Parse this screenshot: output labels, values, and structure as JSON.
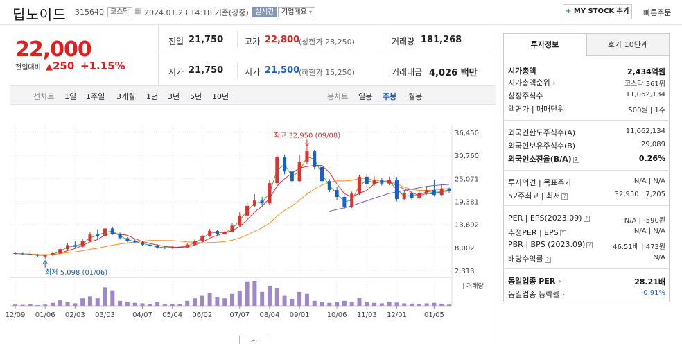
{
  "header": {
    "stock_name": "딥노이드",
    "stock_code": "315640",
    "market": "코스닥",
    "datetime": "2024.01.23 14:18",
    "basis": "기준(장중)",
    "realtime": "실시간",
    "company_info": "기업개요",
    "mystock_button": "MY STOCK 추가",
    "quick_order": "빠른주문"
  },
  "price": {
    "current": "22,000",
    "diff_label": "전일대비",
    "diff_value": "250",
    "diff_pct": "+1.15%"
  },
  "quote": {
    "prev_label": "전일",
    "prev": "21,750",
    "high_label": "고가",
    "high": "22,800",
    "upper_limit": "(상한가 28,250)",
    "volume_label": "거래량",
    "volume": "181,268",
    "open_label": "시가",
    "open": "21,750",
    "low_label": "저가",
    "low": "21,500",
    "lower_limit": "(하한가 15,250)",
    "amount_label": "거래대금",
    "amount": "4,026 백만"
  },
  "periods": {
    "line_label": "선차트",
    "line_items": [
      "1일",
      "1주일",
      "3개월",
      "1년",
      "3년",
      "5년",
      "10년"
    ],
    "candle_label": "봉차트",
    "candle_items": [
      "일봉",
      "주봉",
      "월봉"
    ],
    "active_candle": "주봉"
  },
  "info_tabs": [
    "투자정보",
    "호가 10단계"
  ],
  "info": {
    "rows": [
      {
        "label": "시가총액",
        "value": "2,434억원",
        "bold": true
      },
      {
        "label": "시가총액순위",
        "value": "코스닥 361위"
      },
      {
        "label": "상장주식수",
        "value": "11,062,134"
      },
      {
        "label": "액면가 | 매매단위",
        "value": "500원 | 1주"
      },
      {
        "label": "외국인한도주식수(A)",
        "value": "11,062,134"
      },
      {
        "label": "외국인보유주식수(B)",
        "value": "29,089"
      },
      {
        "label": "외국인소진율(B/A)",
        "value": "0.26%",
        "bold": true
      },
      {
        "label": "투자의견 | 목표주가",
        "value": "N/A | N/A"
      },
      {
        "label": "52주최고 | 최저",
        "value": "32,950 | 7,205"
      },
      {
        "label": "PER | EPS(2023.09)",
        "value": "N/A | -590원"
      },
      {
        "label": "추정PER | EPS",
        "value": "N/A | N/A"
      },
      {
        "label": "PBR | BPS (2023.09)",
        "value": "46.51배 | 473원"
      },
      {
        "label": "배당수익률",
        "value": "N/A"
      },
      {
        "label": "동일업종 PER",
        "value": "28.21배",
        "bold": true
      },
      {
        "label": "동일업종 등락률",
        "value": "-0.91%",
        "blue": true
      }
    ]
  },
  "chart_data": {
    "type": "candlestick",
    "ma_legend": [
      "5",
      "20",
      "60",
      "120"
    ],
    "ma_colors": [
      "#3cb043",
      "#e03131",
      "#ff8c1a",
      "#7e57c2"
    ],
    "up_color": "#e03131",
    "down_color": "#1a5fc8",
    "volume_color": "#9f87c8",
    "volume_label": "거래량",
    "y_ticks": [
      36450,
      30760,
      25071,
      19381,
      13692,
      8002,
      2313
    ],
    "y_tick_labels": [
      "36,450",
      "30,760",
      "25,071",
      "19,381",
      "13,692",
      "8,002",
      "2,313"
    ],
    "ylim": [
      2313,
      36450
    ],
    "x_tick_labels": [
      "12/09",
      "01/06",
      "02/03",
      "03/03",
      "04/07",
      "05/04",
      "06/02",
      "07/07",
      "08/04",
      "09/01",
      "10/06",
      "11/03",
      "12/01",
      "01/05"
    ],
    "x_tick_index": [
      0,
      4,
      8,
      12,
      17,
      21,
      25,
      30,
      34,
      38,
      43,
      47,
      51,
      56
    ],
    "max_annotation": "최고 32,950 (09/08)",
    "max_index": 39,
    "max_value": 32950,
    "min_annotation": "최저 5,098 (01/06)",
    "min_index": 4,
    "min_value": 5098,
    "candles": [
      [
        6600,
        6500,
        6800,
        6300
      ],
      [
        6500,
        6400,
        6700,
        6200
      ],
      [
        6400,
        6200,
        6600,
        6000
      ],
      [
        6200,
        6000,
        6400,
        5700
      ],
      [
        5800,
        6100,
        6300,
        5098
      ],
      [
        6100,
        6600,
        7000,
        5900
      ],
      [
        6600,
        7600,
        7900,
        6400
      ],
      [
        7600,
        8600,
        9100,
        7400
      ],
      [
        8600,
        8200,
        9500,
        7900
      ],
      [
        8200,
        9600,
        10200,
        8000
      ],
      [
        9600,
        11200,
        11800,
        9300
      ],
      [
        11200,
        10800,
        12500,
        10200
      ],
      [
        10800,
        12700,
        13200,
        10500
      ],
      [
        12700,
        11400,
        13000,
        11100
      ],
      [
        11400,
        10300,
        11700,
        10000
      ],
      [
        10300,
        9600,
        10600,
        9300
      ],
      [
        9600,
        9300,
        10000,
        9000
      ],
      [
        9300,
        8700,
        9500,
        8400
      ],
      [
        8700,
        8400,
        9100,
        8100
      ],
      [
        8400,
        8000,
        8800,
        7700
      ],
      [
        8000,
        7900,
        8300,
        7600
      ],
      [
        7900,
        8200,
        8500,
        7700
      ],
      [
        8200,
        8000,
        8400,
        7700
      ],
      [
        8000,
        8700,
        9000,
        7800
      ],
      [
        8700,
        9600,
        10000,
        8500
      ],
      [
        9600,
        10900,
        11400,
        9400
      ],
      [
        10900,
        12100,
        12600,
        10600
      ],
      [
        12100,
        11400,
        12400,
        11000
      ],
      [
        11400,
        11900,
        12400,
        11100
      ],
      [
        11900,
        13400,
        14100,
        11700
      ],
      [
        13400,
        15900,
        16700,
        13100
      ],
      [
        15900,
        18300,
        19300,
        15600
      ],
      [
        18300,
        19600,
        21200,
        17900
      ],
      [
        19600,
        18900,
        20500,
        18300
      ],
      [
        18900,
        23900,
        24700,
        18600
      ],
      [
        23900,
        30400,
        31100,
        23400
      ],
      [
        30400,
        26800,
        31000,
        26100
      ],
      [
        26800,
        24400,
        27400,
        23800
      ],
      [
        24400,
        29100,
        30800,
        24100
      ],
      [
        29100,
        31800,
        32950,
        28700
      ],
      [
        31800,
        27900,
        32200,
        27300
      ],
      [
        27900,
        24400,
        28500,
        23800
      ],
      [
        24400,
        22200,
        24900,
        21700
      ],
      [
        22200,
        20500,
        22900,
        19800
      ],
      [
        20500,
        18100,
        20900,
        17400
      ],
      [
        18100,
        21300,
        21800,
        17700
      ],
      [
        21300,
        25500,
        26000,
        21000
      ],
      [
        25500,
        23600,
        26200,
        22900
      ],
      [
        23600,
        24600,
        25600,
        23300
      ],
      [
        24600,
        23800,
        25300,
        23300
      ],
      [
        23800,
        24800,
        25500,
        23400
      ],
      [
        24800,
        20000,
        25400,
        19400
      ],
      [
        20000,
        21400,
        22100,
        19600
      ],
      [
        21400,
        20300,
        21800,
        19800
      ],
      [
        20300,
        21500,
        22000,
        19900
      ],
      [
        21500,
        22200,
        23200,
        21000
      ],
      [
        22200,
        21000,
        24800,
        20600
      ],
      [
        21000,
        22600,
        23600,
        20700
      ],
      [
        22600,
        22000,
        22800,
        21500
      ]
    ],
    "volume_ratio": [
      0.05,
      0.04,
      0.06,
      0.03,
      0.05,
      0.12,
      0.22,
      0.16,
      0.1,
      0.3,
      0.38,
      0.3,
      0.74,
      0.62,
      0.2,
      0.16,
      0.12,
      0.1,
      0.08,
      0.16,
      0.06,
      0.08,
      0.07,
      0.2,
      0.3,
      0.4,
      0.5,
      0.36,
      0.3,
      0.48,
      0.6,
      0.98,
      1.0,
      0.56,
      0.78,
      0.72,
      0.4,
      0.28,
      0.56,
      0.48,
      0.2,
      0.15,
      0.12,
      0.16,
      0.2,
      0.14,
      0.32,
      0.16,
      0.12,
      0.1,
      0.14,
      0.13,
      0.1,
      0.09,
      0.07,
      0.1,
      0.12,
      0.08,
      0.05
    ]
  }
}
